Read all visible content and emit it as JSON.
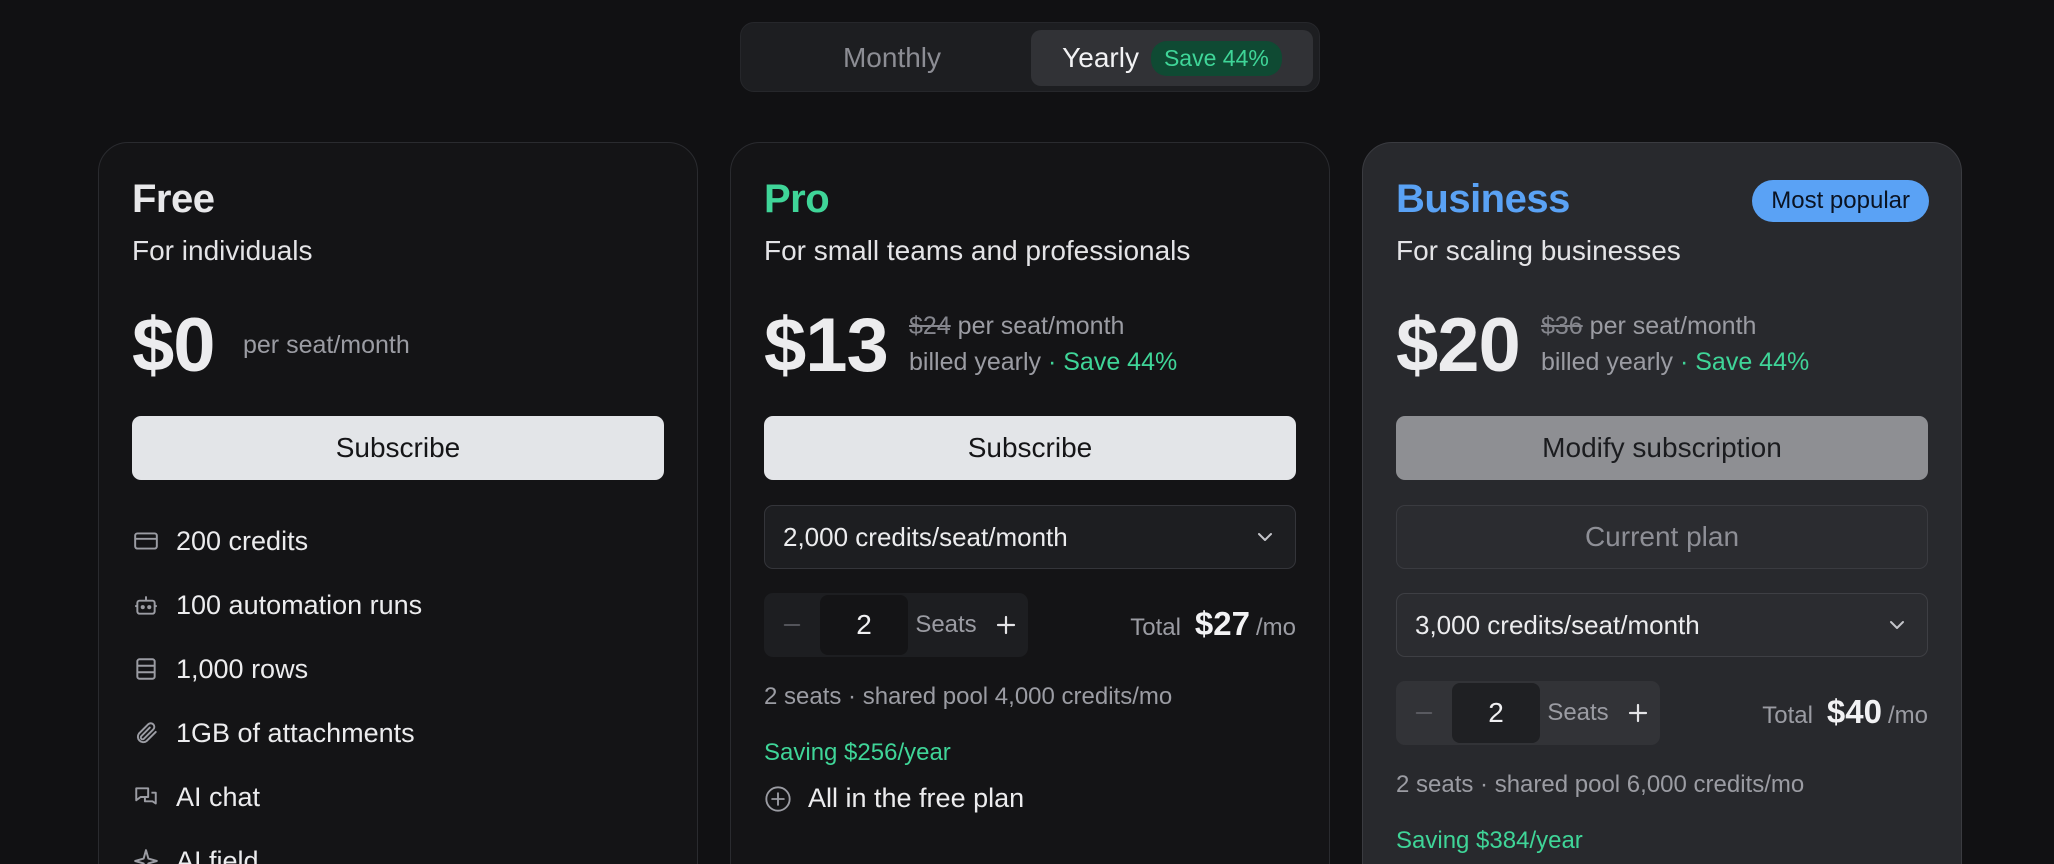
{
  "billing_toggle": {
    "monthly_label": "Monthly",
    "yearly_label": "Yearly",
    "yearly_badge": "Save 44%",
    "selected": "Yearly"
  },
  "plans": {
    "free": {
      "name": "Free",
      "tagline": "For individuals",
      "price": "$0",
      "price_unit": "per seat/month",
      "button_label": "Subscribe",
      "features": [
        {
          "icon": "credit-card-icon",
          "label": "200 credits"
        },
        {
          "icon": "robot-icon",
          "label": "100 automation runs"
        },
        {
          "icon": "rows-icon",
          "label": "1,000 rows"
        },
        {
          "icon": "paperclip-icon",
          "label": "1GB of attachments"
        },
        {
          "icon": "chat-icon",
          "label": "AI chat"
        },
        {
          "icon": "sparkle-icon",
          "label": "AI field"
        }
      ]
    },
    "pro": {
      "name": "Pro",
      "tagline": "For small teams and professionals",
      "price": "$13",
      "original_price": "$24",
      "price_unit": "per seat/month",
      "billing_note": "billed yearly",
      "save_note": "· Save 44%",
      "button_label": "Subscribe",
      "credits_option": "2,000 credits/seat/month",
      "seats_value": "2",
      "seats_label": "Seats",
      "total_label": "Total",
      "total_amount": "$27",
      "total_unit": "/mo",
      "pool_text": "2 seats · shared pool 4,000 credits/mo",
      "saving_text": "Saving $256/year",
      "included_text": "All in the free plan"
    },
    "business": {
      "name": "Business",
      "badge": "Most popular",
      "tagline": "For scaling businesses",
      "price": "$20",
      "original_price": "$36",
      "price_unit": "per seat/month",
      "billing_note": "billed yearly",
      "save_note": "· Save 44%",
      "button_label": "Modify subscription",
      "current_label": "Current plan",
      "credits_option": "3,000 credits/seat/month",
      "seats_value": "2",
      "seats_label": "Seats",
      "total_label": "Total",
      "total_amount": "$40",
      "total_unit": "/mo",
      "pool_text": "2 seats · shared pool 6,000 credits/mo",
      "saving_text": "Saving $384/year"
    }
  },
  "colors": {
    "background": "#111113",
    "accent_green": "#3fd598",
    "accent_blue": "#5aa2f5",
    "card_highlight": "#28292d"
  }
}
